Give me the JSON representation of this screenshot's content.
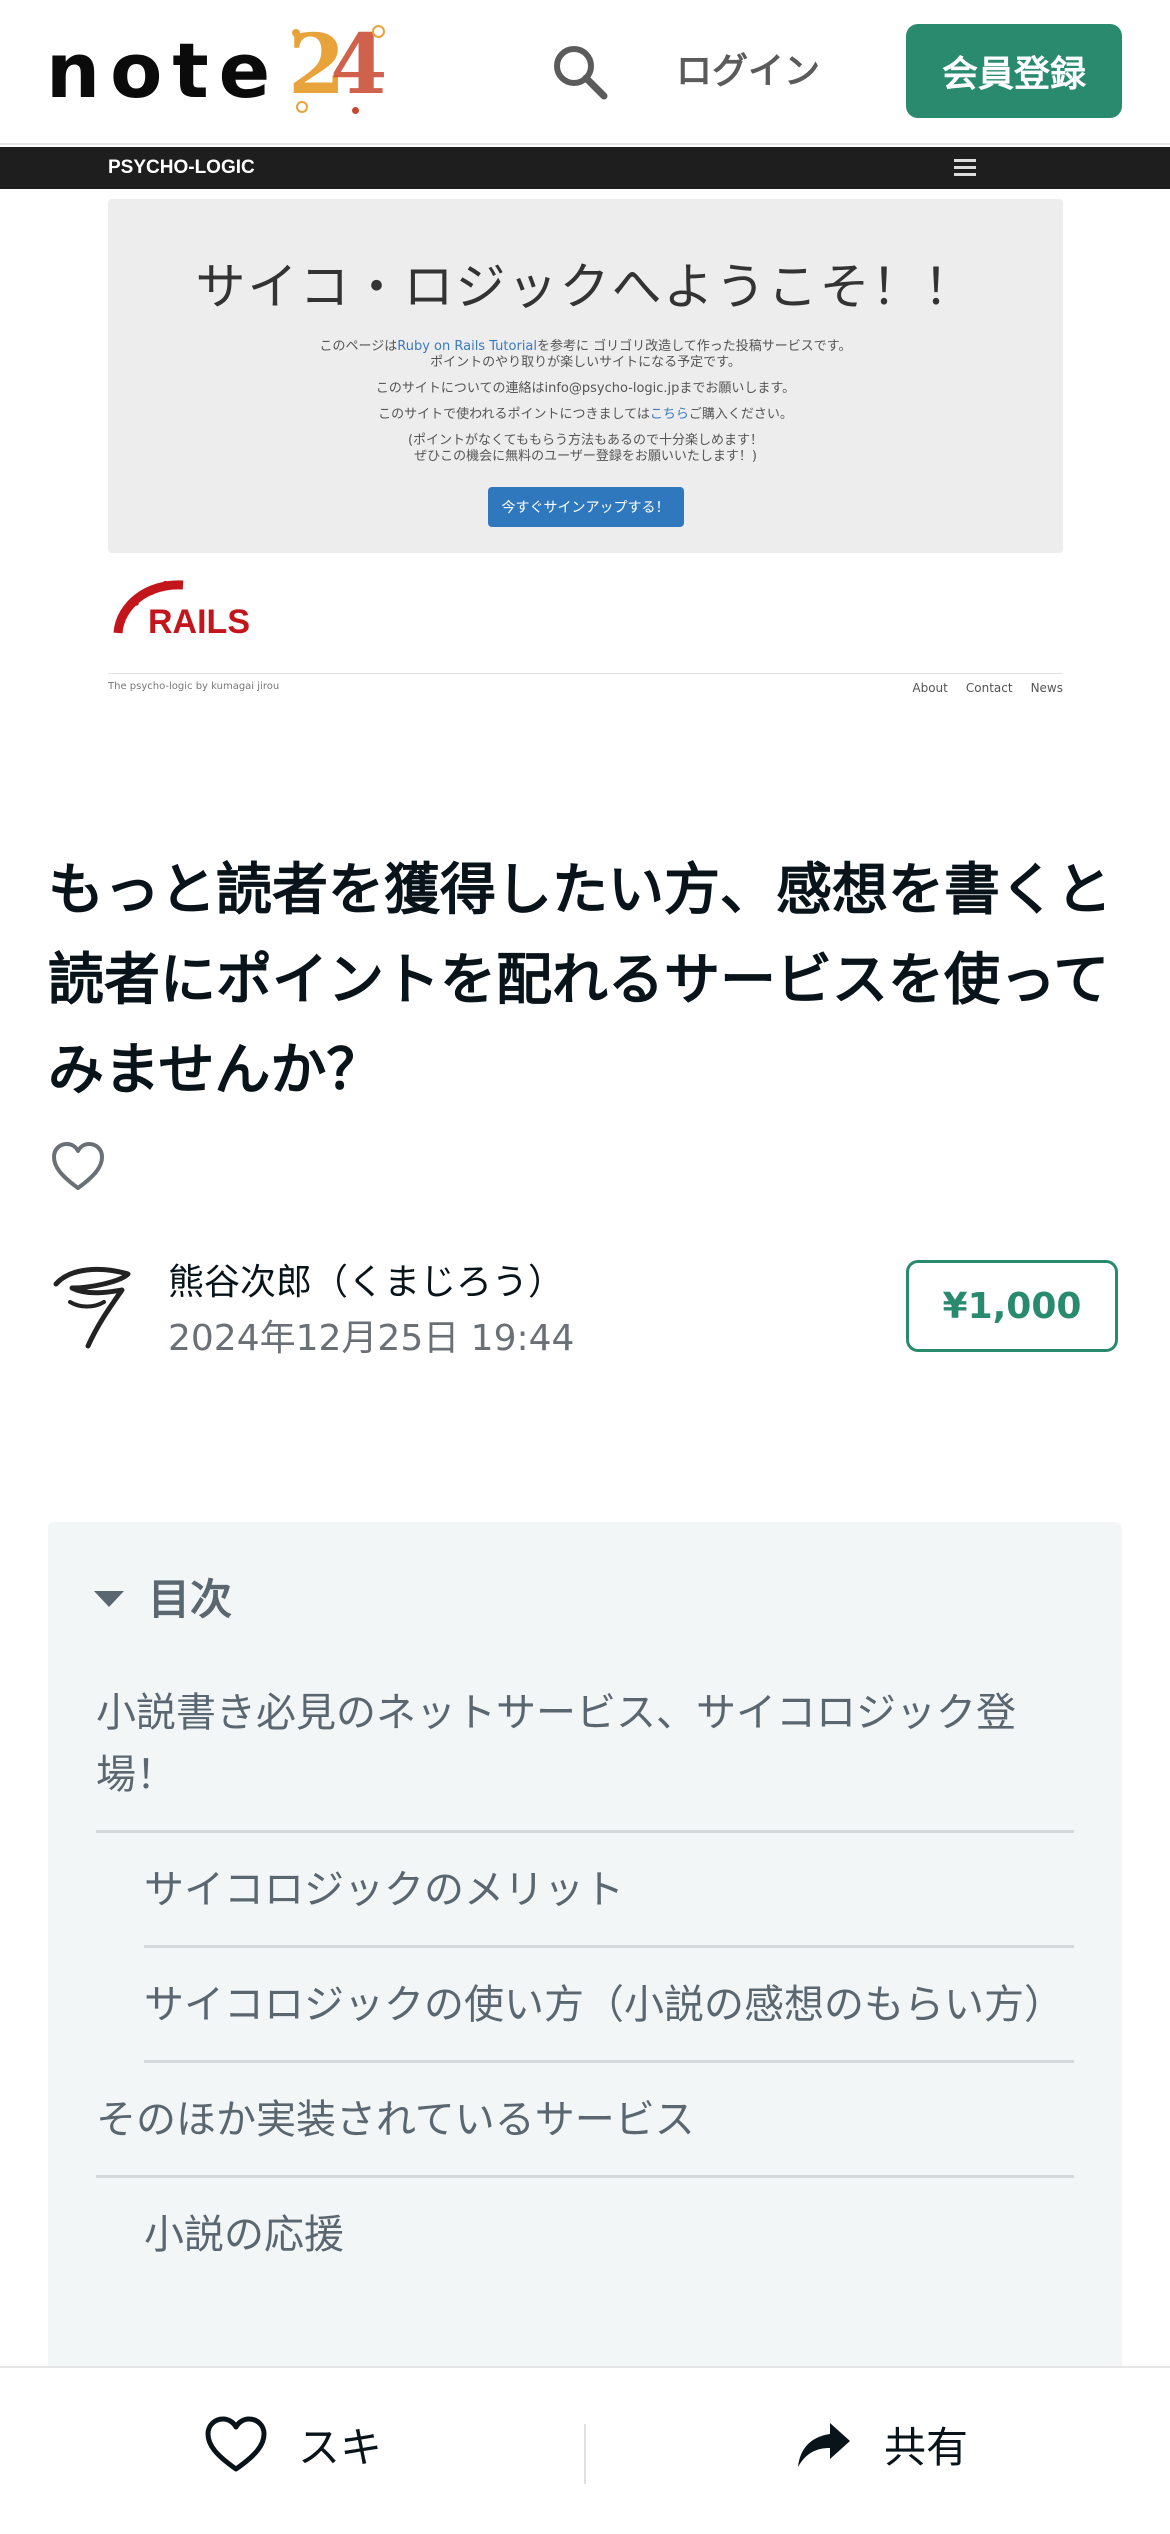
{
  "header": {
    "logo_text": "note",
    "logo_badge_2": "2",
    "logo_badge_4": "4",
    "search_icon": "search-icon",
    "login_label": "ログイン",
    "signup_label": "会員登録"
  },
  "embedded_screenshot": {
    "brand": "PSYCHO-LOGIC",
    "menu_icon": "hamburger-icon",
    "hero_title": "サイコ・ロジックへようこそ！！",
    "line1_a": "このページは",
    "line1_link": "Ruby on Rails Tutorial",
    "line1_b": "を参考に ゴリゴリ改造して作った投稿サービスです。",
    "line2": "ポイントのやり取りが楽しいサイトになる予定です。",
    "line3": "このサイトについての連絡はinfo@psycho-logic.jpまでお願いします。",
    "line4_a": "このサイトで使われるポイントにつきましては",
    "line4_link": "こちら",
    "line4_b": "ご購入ください。",
    "line5": "(ポイントがなくてももらう方法もあるので十分楽しめます！",
    "line6": "ぜひこの機会に無料のユーザー登録をお願いいたします！)",
    "cta": "今すぐサインアップする！",
    "rails_logo_text": "RAILS",
    "footer_left": "The psycho-logic by kumagai jirou",
    "footer_links": [
      "About",
      "Contact",
      "News"
    ]
  },
  "article": {
    "title": "もっと読者を獲得したい方、感想を書くと読者にポイントを配れるサービスを使ってみませんか？",
    "author": "熊谷次郎（くまじろう）",
    "date": "2024年12月25日 19:44",
    "price": "¥1,000"
  },
  "toc": {
    "heading": "目次",
    "items": [
      {
        "label": "小説書き必見のネットサービス、サイコロジック登場！",
        "level": 1
      },
      {
        "label": "サイコロジックのメリット",
        "level": 2
      },
      {
        "label": "サイコロジックの使い方（小説の感想のもらい方）",
        "level": 2
      },
      {
        "label": "そのほか実装されているサービス",
        "level": 1
      },
      {
        "label": "小説の応援",
        "level": 2
      }
    ]
  },
  "bottom_bar": {
    "like_label": "スキ",
    "share_label": "共有"
  },
  "colors": {
    "brand_green": "#2a8a6d",
    "text": "#08131a",
    "muted": "#5b6770"
  }
}
